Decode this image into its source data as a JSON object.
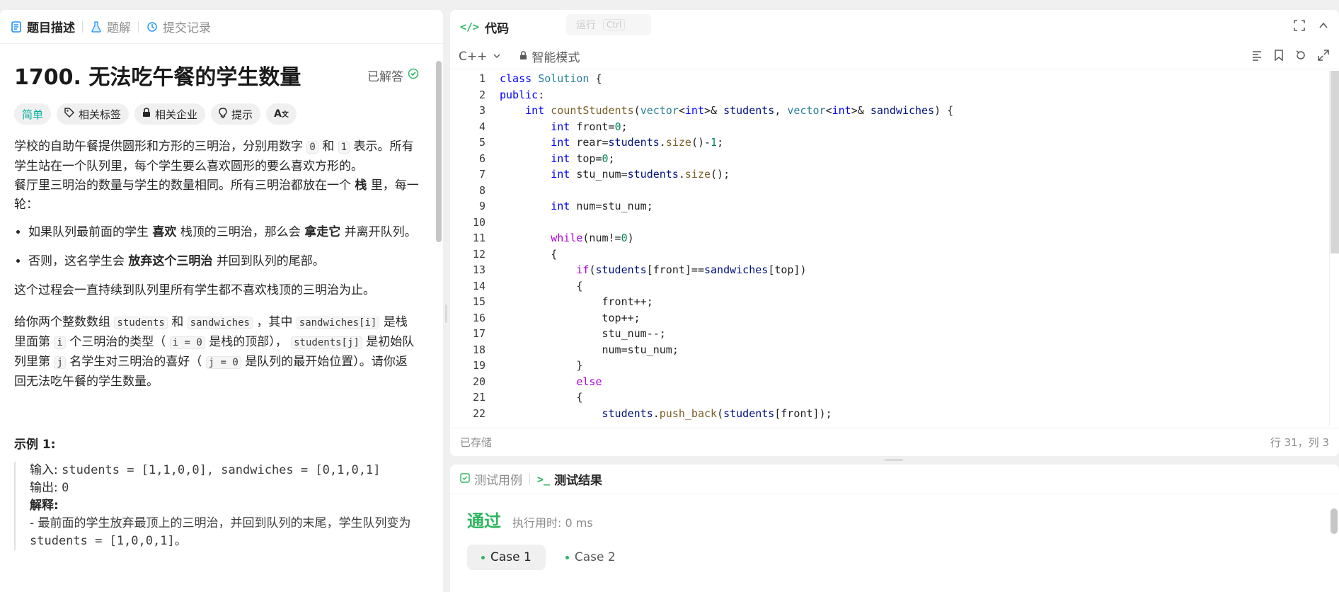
{
  "left_tabs": [
    {
      "label": "题目描述",
      "icon": "description-icon"
    },
    {
      "label": "题解",
      "icon": "flask-icon"
    },
    {
      "label": "提交记录",
      "icon": "history-icon"
    }
  ],
  "problem": {
    "title": "1700. 无法吃午餐的学生数量",
    "solved_label": "已解答",
    "chips": {
      "difficulty": "简单",
      "tags": "相关标签",
      "companies": "相关企业",
      "hint": "提示"
    },
    "desc": {
      "p1a": "学校的自助午餐提供圆形和方形的三明治，分别用数字",
      "p1code0": "0",
      "p1b": "和",
      "p1code1": "1",
      "p1c": "表示。所有学生站在一个队列里，每个学生要么喜欢圆形的要么喜欢方形的。",
      "p2a": "餐厅里三明治的数量与学生的数量相同。所有三明治都放在一个",
      "p2b": "栈",
      "p2c": "里，每一轮：",
      "li1a": "如果队列最前面的学生",
      "li1b": "喜欢",
      "li1c": "栈顶的三明治，那么会",
      "li1d": "拿走它",
      "li1e": "并离开队列。",
      "li2a": "否则，这名学生会",
      "li2b": "放弃这个三明治",
      "li2c": "并回到队列的尾部。",
      "p3": "这个过程会一直持续到队列里所有学生都不喜欢栈顶的三明治为止。",
      "p4a": "给你两个整数数组",
      "c_students": "students",
      "p4b": "和",
      "c_sandwiches": "sandwiches",
      "p4c": "，其中",
      "c_sandi": "sandwiches[i]",
      "p4d": "是栈里面第",
      "c_i": "i",
      "p4e": "个三明治的类型（",
      "c_i0": "i = 0",
      "p4f": "是栈的顶部），",
      "c_studj": "students[j]",
      "p4g": "是初始队列里第",
      "c_j": "j",
      "p4h": "名学生对三明治的喜好（",
      "c_j0": "j = 0",
      "p4i": "是队列的最开始位置）。请你返回无法吃午餐的学生数量。"
    },
    "example": {
      "title": "示例 1:",
      "input_label": "输入:",
      "input": "students = [1,1,0,0], sandwiches = [0,1,0,1]",
      "output_label": "输出:",
      "output": "0",
      "explain_label": "解释:",
      "explain1": "- 最前面的学生放弃最顶上的三明治，并回到队列的末尾，学生队列变为",
      "explain1_code": "students = [1,0,0,1]。"
    }
  },
  "code_panel": {
    "title": "代码",
    "run_label": "运行",
    "run_kbd": "Ctrl",
    "language": "C++",
    "mode": "智能模式",
    "saved": "已存储",
    "cursor": "行 31，列 3"
  },
  "code_lines": [
    "1",
    "2",
    "3",
    "4",
    "5",
    "6",
    "7",
    "8",
    "9",
    "10",
    "11",
    "12",
    "13",
    "14",
    "15",
    "16",
    "17",
    "18",
    "19",
    "20",
    "21",
    "22"
  ],
  "result_panel": {
    "tab_testcase": "测试用例",
    "tab_result": "测试结果",
    "status": "通过",
    "runtime": "执行用时: 0 ms",
    "case1": "Case 1",
    "case2": "Case 2"
  }
}
